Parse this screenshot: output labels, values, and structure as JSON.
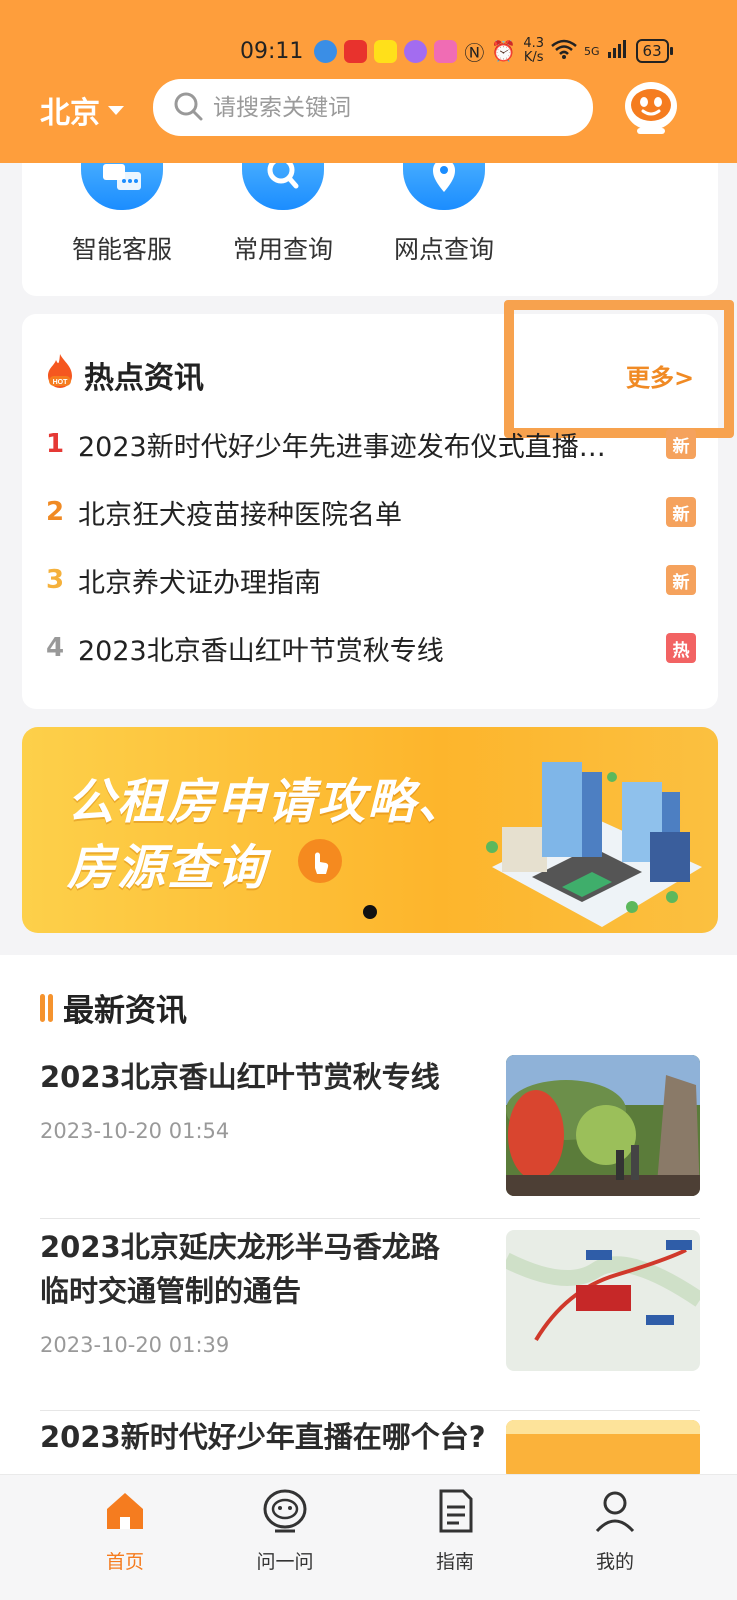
{
  "status_bar": {
    "time": "09:11",
    "net_speed_value": "4.3",
    "net_speed_unit": "K/s",
    "signal": "5G",
    "battery": "63"
  },
  "header": {
    "city": "北京",
    "search_placeholder": "请搜索关键词"
  },
  "services": [
    {
      "label": "智能客服",
      "icon": "chat-icon"
    },
    {
      "label": "常用查询",
      "icon": "search-icon"
    },
    {
      "label": "网点查询",
      "icon": "location-pin-icon"
    }
  ],
  "hot_news": {
    "title": "热点资讯",
    "more": "更多>",
    "items": [
      {
        "rank": "1",
        "text": "2023新时代好少年先进事迹发布仪式直播…",
        "badge": "新",
        "rank_color": "#e53935",
        "badge_color": "#f5a25d"
      },
      {
        "rank": "2",
        "text": "北京狂犬疫苗接种医院名单",
        "badge": "新",
        "rank_color": "#f08a24",
        "badge_color": "#f5a25d"
      },
      {
        "rank": "3",
        "text": "北京养犬证办理指南",
        "badge": "新",
        "rank_color": "#f5b13c",
        "badge_color": "#f5a25d"
      },
      {
        "rank": "4",
        "text": "2023北京香山红叶节赏秋专线",
        "badge": "热",
        "rank_color": "#999999",
        "badge_color": "#f26363"
      }
    ]
  },
  "banner": {
    "line1": "公租房申请攻略、",
    "line2": "房源查询"
  },
  "latest_news": {
    "title": "最新资讯",
    "items": [
      {
        "title": "2023北京香山红叶节赏秋专线",
        "time": "2023-10-20 01:54"
      },
      {
        "title": "2023北京延庆龙形半马香龙路临时交通管制的通告",
        "time": "2023-10-20 01:39"
      },
      {
        "title": "2023新时代好少年直播在哪个台?",
        "time": ""
      }
    ]
  },
  "tabbar": [
    {
      "label": "首页",
      "icon": "home-icon",
      "active": true
    },
    {
      "label": "问一问",
      "icon": "robot-icon",
      "active": false
    },
    {
      "label": "指南",
      "icon": "document-icon",
      "active": false
    },
    {
      "label": "我的",
      "icon": "user-icon",
      "active": false
    }
  ],
  "colors": {
    "brand": "#fe9e3c",
    "accent": "#f57c1f"
  }
}
